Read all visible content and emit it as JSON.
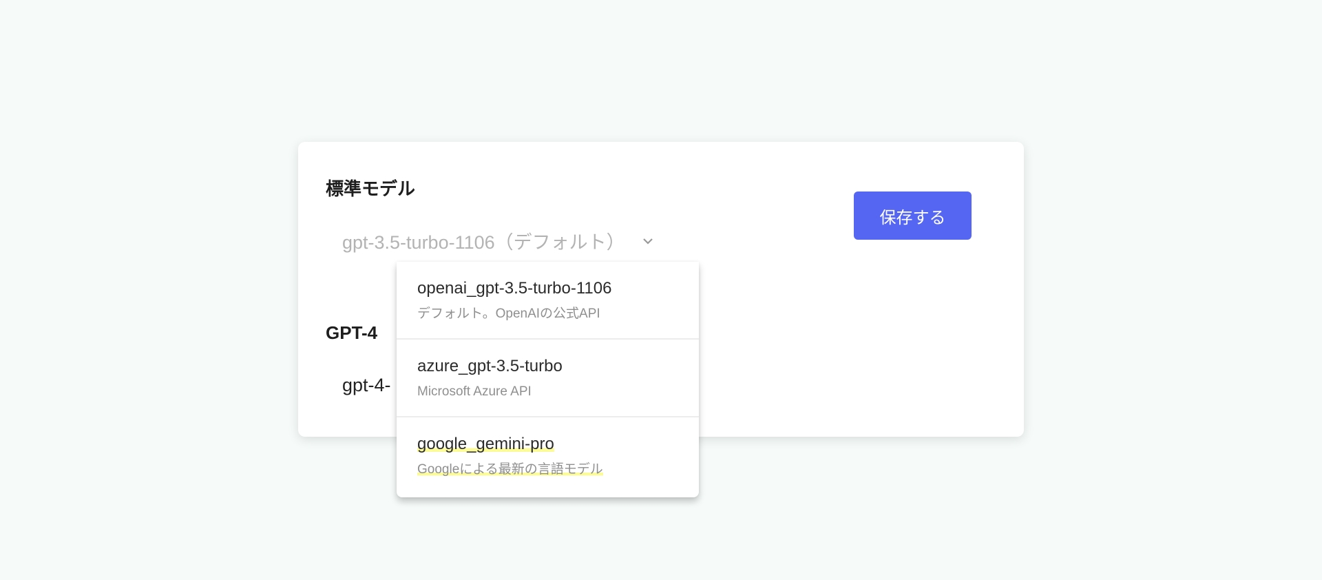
{
  "sections": [
    {
      "label": "標準モデル",
      "selected": "gpt-3.5-turbo-1106（デフォルト）"
    },
    {
      "label": "GPT-4",
      "selected": "gpt-4-"
    }
  ],
  "save_label": "保存する",
  "dropdown": {
    "options": [
      {
        "name": "openai_gpt-3.5-turbo-1106",
        "desc": "デフォルト。OpenAIの公式API"
      },
      {
        "name": "azure_gpt-3.5-turbo",
        "desc": "Microsoft Azure API"
      },
      {
        "name": "google_gemini-pro",
        "desc": "Googleによる最新の言語モデル"
      }
    ]
  },
  "colors": {
    "accent": "#5566f3",
    "background": "#f6fbf9",
    "highlight": "#fbfb9a"
  }
}
